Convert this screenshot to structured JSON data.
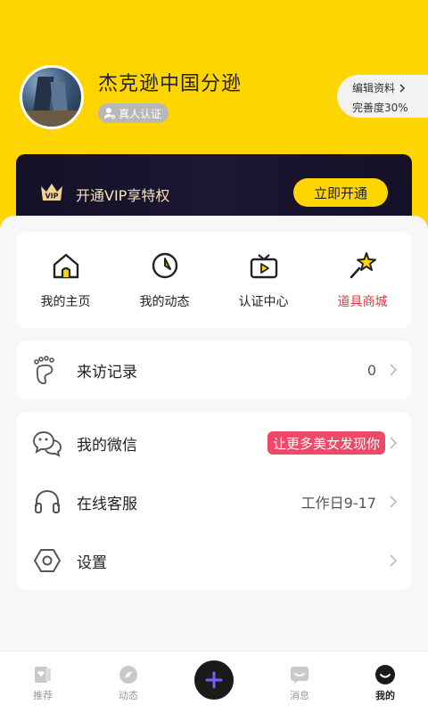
{
  "profile": {
    "name": "杰克逊中国分逊",
    "verify_label": "真人认证",
    "edit_label": "编辑资料",
    "completeness_label": "完善度30%"
  },
  "vip": {
    "text": "开通VIP享特权",
    "badge": "VIP",
    "button": "立即开通",
    "colors": {
      "accent": "#ffd500",
      "card": "#141026",
      "text": "#f5e2b8"
    }
  },
  "quick_actions": [
    {
      "label": "我的主页",
      "icon": "home-icon"
    },
    {
      "label": "我的动态",
      "icon": "clock-icon"
    },
    {
      "label": "认证中心",
      "icon": "tv-play-icon"
    },
    {
      "label": "道具商城",
      "icon": "magic-wand-star-icon",
      "highlight": "#e23b45"
    }
  ],
  "visits": {
    "label": "来访记录",
    "value": "0",
    "icon": "footprint-icon"
  },
  "menu": {
    "wechat": {
      "label": "我的微信",
      "tag": "让更多美女发现你",
      "icon": "chat-bubbles-icon"
    },
    "service": {
      "label": "在线客服",
      "value": "工作日9-17",
      "icon": "headphones-icon"
    },
    "settings": {
      "label": "设置",
      "icon": "hexagon-gear-icon"
    }
  },
  "tabbar": {
    "items": [
      {
        "label": "推荐",
        "icon": "cards-icon"
      },
      {
        "label": "动态",
        "icon": "compass-icon"
      },
      {
        "label": "",
        "icon": "plus-icon"
      },
      {
        "label": "消息",
        "icon": "message-icon"
      },
      {
        "label": "我的",
        "icon": "smile-icon",
        "active": true
      }
    ]
  }
}
